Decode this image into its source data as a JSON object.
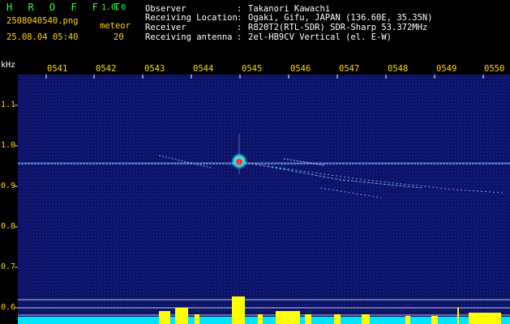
{
  "header": {
    "app_title": "H R O F F T",
    "version": "1.0.0",
    "filename": "2508040540.png",
    "mode": "meteor",
    "timestamp": "25.08.04 05:40",
    "count": "20"
  },
  "info": [
    {
      "key": "Observer",
      "value": "Takanori Kawachi"
    },
    {
      "key": "Receiving Location",
      "value": "Ogaki, Gifu, JAPAN (136.60E, 35.35N)"
    },
    {
      "key": "Receiver",
      "value": "R820T2(RTL-SDR) SDR-Sharp 53.372MHz"
    },
    {
      "key": "Receiving antenna",
      "value": "2el-HB9CV Vertical (el. E-W)"
    }
  ],
  "axis": {
    "y_unit": "kHz",
    "time_ticks": [
      "0541",
      "0542",
      "0543",
      "0544",
      "0545",
      "0546",
      "0547",
      "0548",
      "0549",
      "0550"
    ],
    "freq_ticks": [
      "1.1",
      "1.0",
      "0.9",
      "0.8",
      "0.7",
      "0.6"
    ]
  },
  "colors": {
    "background": "#000000",
    "spectrogram_bg": "#0a0f66",
    "label_yellow": "#ffd700",
    "title_green": "#33ff33",
    "signal_line": "#5aa9ff",
    "meteor_head": "#ff4040",
    "level_cyan": "#00e5ff",
    "level_yellow": "#ffff00"
  }
}
